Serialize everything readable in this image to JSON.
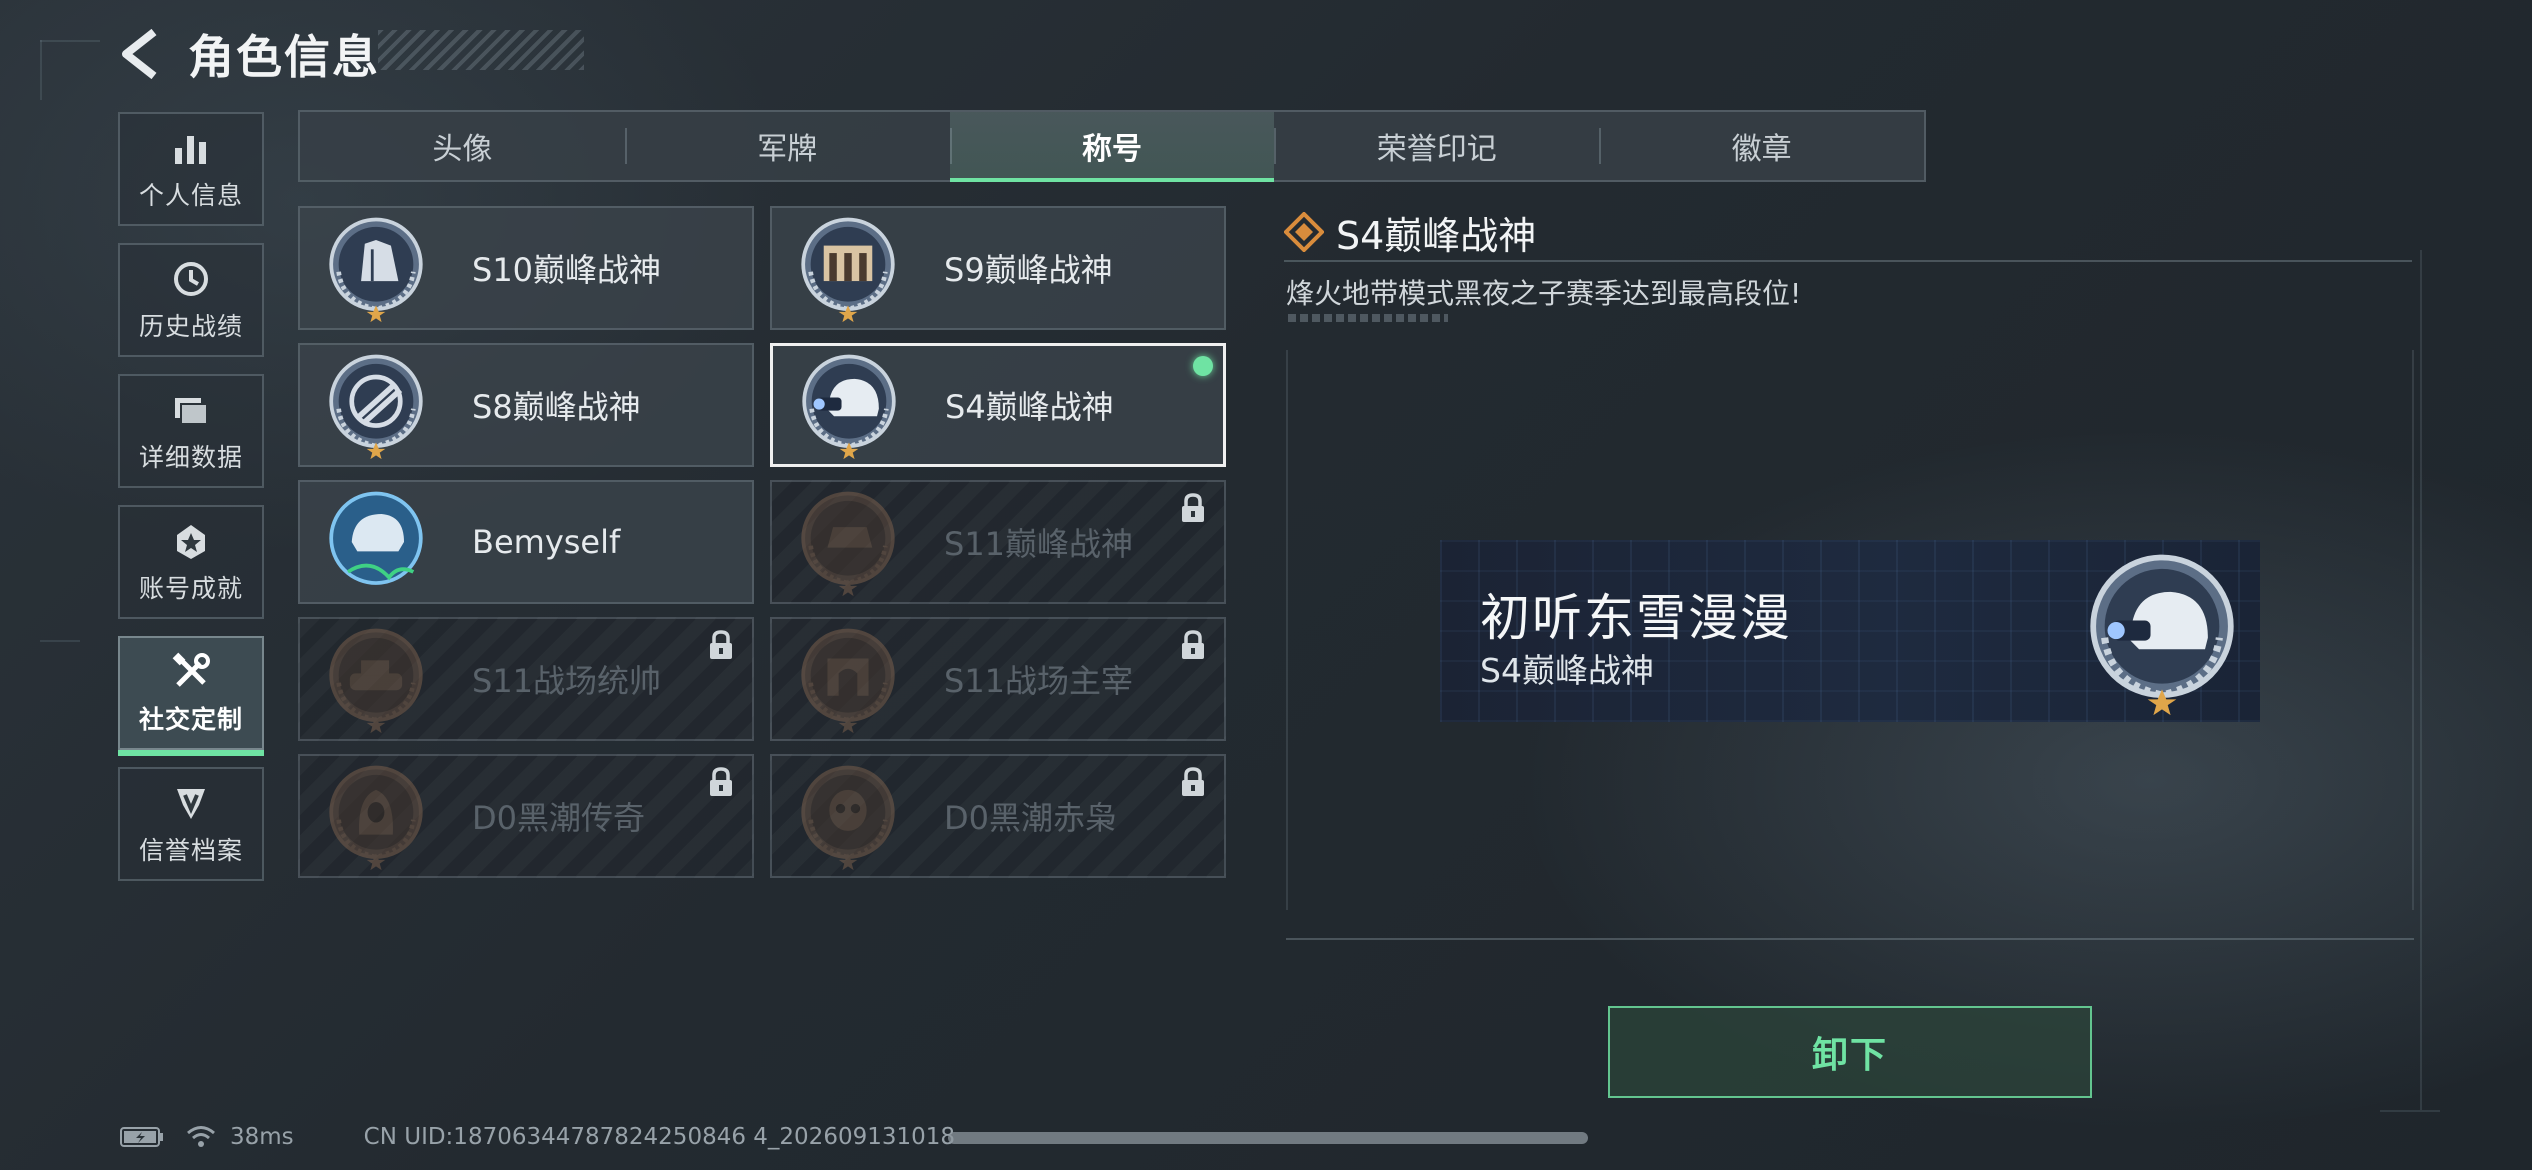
{
  "header": {
    "title": "角色信息"
  },
  "sidebar": {
    "items": [
      {
        "label": "个人信息",
        "icon": "bar-chart-icon"
      },
      {
        "label": "历史战绩",
        "icon": "history-clock-icon"
      },
      {
        "label": "详细数据",
        "icon": "folder-icon"
      },
      {
        "label": "账号成就",
        "icon": "achievement-medal-icon"
      },
      {
        "label": "社交定制",
        "icon": "tools-icon",
        "active": true
      },
      {
        "label": "信誉档案",
        "icon": "reputation-shield-icon"
      }
    ]
  },
  "tabs": [
    {
      "label": "头像"
    },
    {
      "label": "军牌"
    },
    {
      "label": "称号",
      "active": true
    },
    {
      "label": "荣誉印记"
    },
    {
      "label": "徽章"
    }
  ],
  "titles": [
    {
      "name": "S10巅峰战神",
      "locked": false
    },
    {
      "name": "S9巅峰战神",
      "locked": false
    },
    {
      "name": "S8巅峰战神",
      "locked": false
    },
    {
      "name": "S4巅峰战神",
      "locked": false,
      "selected": true,
      "equipped": true
    },
    {
      "name": "Bemyself",
      "locked": false
    },
    {
      "name": "S11巅峰战神",
      "locked": true
    },
    {
      "name": "S11战场统帅",
      "locked": true
    },
    {
      "name": "S11战场主宰",
      "locked": true
    },
    {
      "name": "D0黑潮传奇",
      "locked": true
    },
    {
      "name": "D0黑潮赤枭",
      "locked": true
    }
  ],
  "detail": {
    "title": "S4巅峰战神",
    "description": "烽火地带模式黑夜之子赛季达到最高段位!",
    "preview": {
      "player_name": "初听东雪漫漫",
      "title": "S4巅峰战神"
    }
  },
  "actions": {
    "unequip_label": "卸下"
  },
  "status": {
    "ping": "38ms",
    "uid": "CN UID:18706344787824250846 4_202609131018"
  },
  "colors": {
    "accent": "#6fe3a3",
    "locked_text": "#59626a",
    "medal_gold": "#e0a64a"
  }
}
